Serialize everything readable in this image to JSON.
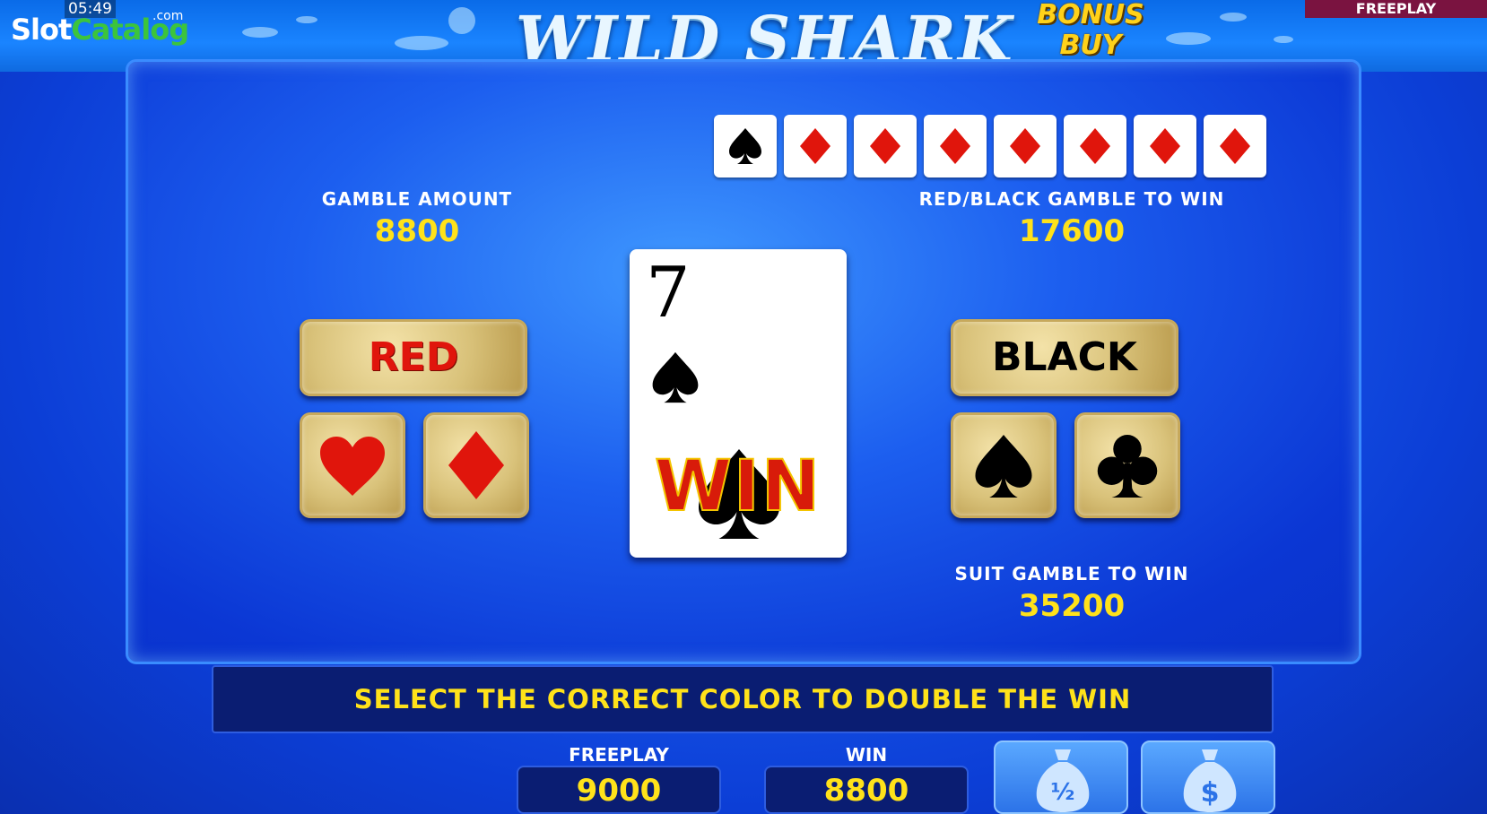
{
  "header": {
    "clock": "05:49",
    "site_logo_part1": "Slot",
    "site_logo_part2": "Catalog",
    "site_logo_suffix": ".com",
    "game_title": "WILD SHARK",
    "bonus_badge_line1": "BONUS",
    "bonus_badge_line2": "BUY",
    "mode_tag": "FREEPLAY"
  },
  "history": {
    "cards": [
      "spade",
      "diamond",
      "diamond",
      "diamond",
      "diamond",
      "diamond",
      "diamond",
      "diamond"
    ]
  },
  "gamble_amount": {
    "label": "GAMBLE AMOUNT",
    "value": "8800"
  },
  "red_black": {
    "label": "RED/BLACK GAMBLE TO WIN",
    "value": "17600"
  },
  "suit_gamble": {
    "label": "SUIT GAMBLE TO WIN",
    "value": "35200"
  },
  "buttons": {
    "red_label": "RED",
    "black_label": "BLACK",
    "hearts_icon": "heart-icon",
    "diamonds_icon": "diamond-icon",
    "spades_icon": "spade-icon",
    "clubs_icon": "club-icon"
  },
  "card": {
    "rank": "7",
    "suit": "spade",
    "result": "WIN"
  },
  "message": "SELECT THE CORRECT COLOR TO DOUBLE THE WIN",
  "footer": {
    "freeplay_label": "FREEPLAY",
    "freeplay_value": "9000",
    "win_label": "WIN",
    "win_value": "8800",
    "half_collect_icon": "money-bag-half-icon",
    "collect_icon": "money-bag-dollar-icon"
  },
  "colors": {
    "accent_yellow": "#ffe21a",
    "red_suit": "#e0150c",
    "black_suit": "#000000",
    "panel_blue": "#1c5eef"
  }
}
